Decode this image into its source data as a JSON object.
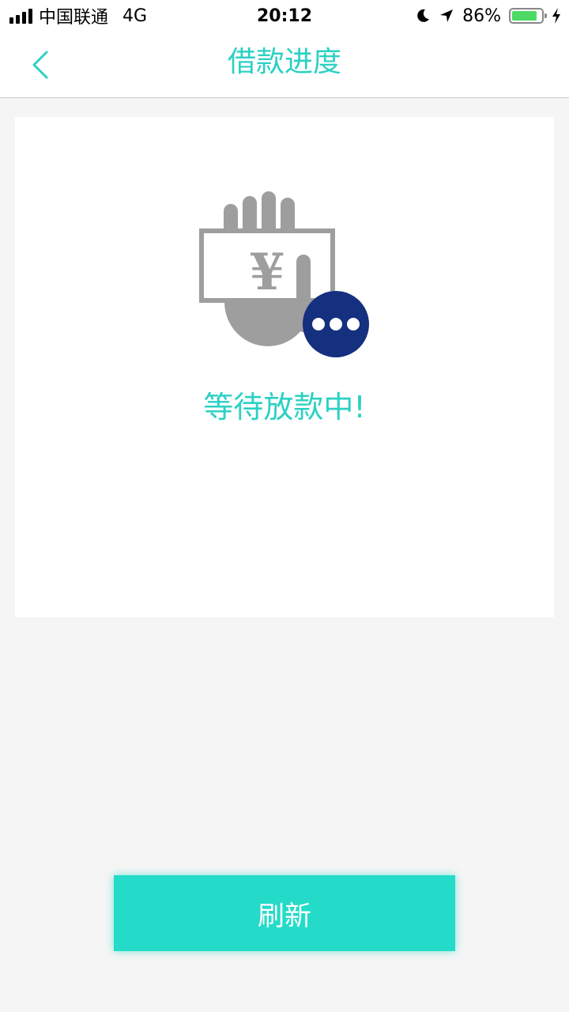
{
  "status_bar": {
    "carrier": "中国联通",
    "network": "4G",
    "time": "20:12",
    "battery": "86%",
    "battery_level": 0.86,
    "icons": [
      "signal-icon",
      "moon-icon",
      "location-arrow-icon",
      "battery-icon",
      "charging-bolt-icon"
    ]
  },
  "nav": {
    "title": "借款进度",
    "back_icon": "chevron-left-icon"
  },
  "card": {
    "illustration_icon": "hand-money-pending-icon",
    "currency_symbol": "¥",
    "status_text": "等待放款中!"
  },
  "actions": {
    "refresh_label": "刷新"
  },
  "colors": {
    "accent": "#2bd1c3",
    "button": "#23dbc8",
    "pending_badge": "#14307f",
    "illustration_gray": "#9e9e9e",
    "background": "#f5f5f5"
  }
}
